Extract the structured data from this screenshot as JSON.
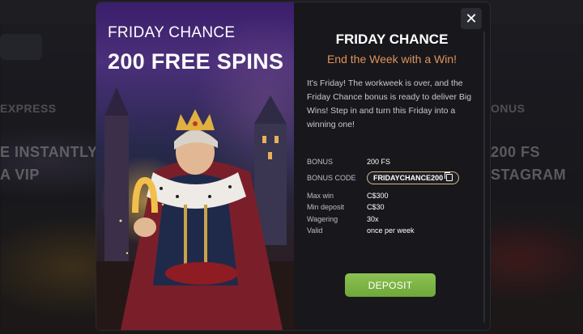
{
  "background": {
    "left_texts": [
      "EXPRESS",
      "E INSTANTLY",
      "A VIP"
    ],
    "right_texts": [
      "ONUS",
      "200 FS",
      "STAGRAM"
    ]
  },
  "modal": {
    "close_icon": "close-icon",
    "promo": {
      "subtitle": "FRIDAY CHANCE",
      "headline": "200 FREE SPINS"
    },
    "title": "FRIDAY CHANCE",
    "tagline": "End the Week with a Win!",
    "description": "It's Friday! The workweek is over, and the Friday Chance bonus is ready to deliver Big Wins! Step in and turn this Friday into a winning one!",
    "terms": {
      "bonus_label": "BONUS",
      "bonus_value": "200 FS",
      "code_label": "BONUS CODE",
      "code_value": "FRIDAYCHANCE200",
      "maxwin_label": "Max win",
      "maxwin_value": "C$300",
      "mindep_label": "Min deposit",
      "mindep_value": "C$30",
      "wager_label": "Wagering",
      "wager_value": "30x",
      "valid_label": "Valid",
      "valid_value": "once per week"
    },
    "deposit_label": "DEPOSIT",
    "colors": {
      "accent_tagline": "#e0935a",
      "deposit_green": "#7cb342",
      "code_border": "#d8b98a"
    }
  }
}
